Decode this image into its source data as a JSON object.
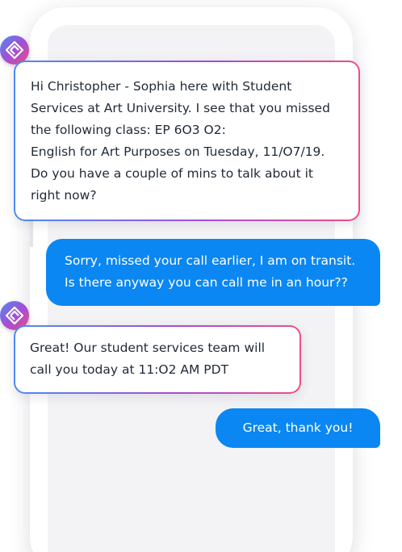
{
  "messages": [
    {
      "sender": "bot",
      "lines": [
        "Hi Christopher - Sophia here with Student",
        "Services at Art University. I see that you missed",
        "the following class: EP 6O3 O2:",
        "English for Art Purposes on Tuesday, 11/O7/19.",
        "Do you have a couple of mins to talk about it",
        "right now?"
      ]
    },
    {
      "sender": "user",
      "lines": [
        "Sorry, missed your call earlier, I am on transit.",
        "Is there anyway you can call me in an hour??"
      ]
    },
    {
      "sender": "bot",
      "lines": [
        "Great! Our student services team will",
        "call you today at 11:O2 AM PDT"
      ]
    },
    {
      "sender": "user",
      "lines": [
        "Great, thank you!"
      ]
    }
  ],
  "colors": {
    "outgoing_bubble": "#0a87f2",
    "gradient_start": "#4c8cf1",
    "gradient_mid": "#a14fd6",
    "gradient_end": "#ef4d86",
    "incoming_text": "#1f2a36"
  },
  "icons": {
    "bot_avatar": "diamond-logo-icon"
  }
}
